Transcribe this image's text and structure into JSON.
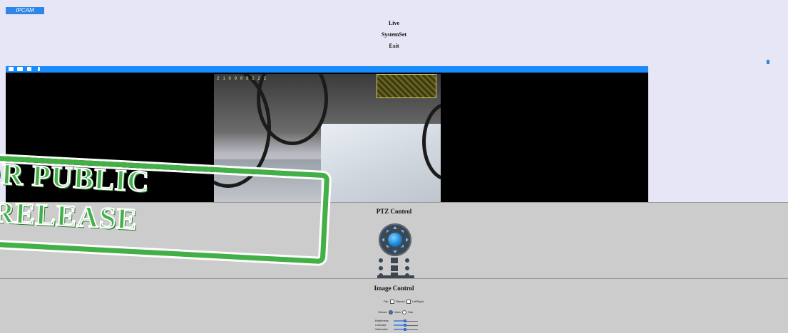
{
  "app": {
    "logo_text": "IPCAM"
  },
  "nav": {
    "live": "Live",
    "systemset": "SystemSet",
    "exit": "Exit"
  },
  "video": {
    "toolbar_icons": [
      "speaker-icon",
      "record-icon",
      "snapshot-icon",
      "microphone-icon"
    ],
    "timestamp": "2 1 0 9 0 8 2 2 2"
  },
  "ptz": {
    "title": "PTZ Control"
  },
  "image_control": {
    "title": "Image Control",
    "flip_label": "Flip",
    "flip_option": "Flipvad",
    "mirror_option": "LeftRight",
    "stream_label": "Stream",
    "stream_main": "Main",
    "stream_sub": "Sub",
    "brightness_label": "Brightness",
    "contrast_label": "Contrast",
    "saturation_label": "Saturation"
  },
  "watermark": {
    "line1": "OR PUBLIC",
    "line2": "RELEASE"
  },
  "colors": {
    "page_bg": "#e6e6f6",
    "accent_blue": "#1a8bff",
    "panel_gray": "#cccccc",
    "stamp_green": "#43b047"
  }
}
